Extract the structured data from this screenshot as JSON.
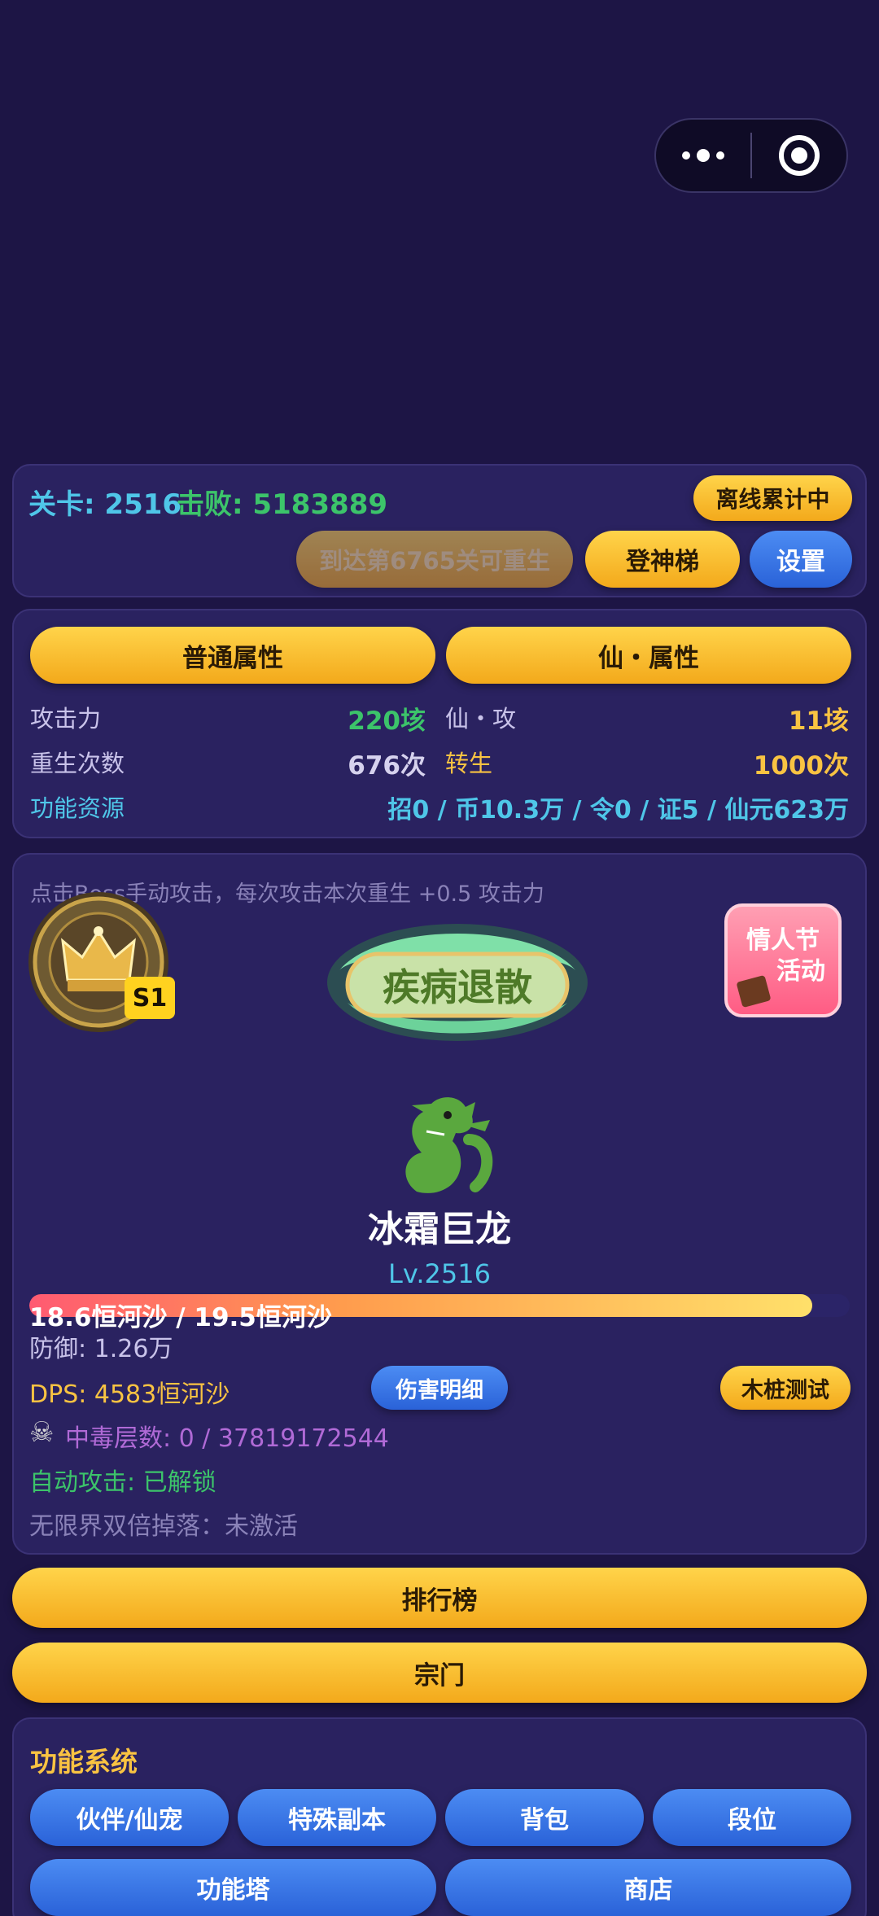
{
  "top": {
    "level_label": "关卡: 2516",
    "kills_label": "击败: 5183889",
    "offline_btn": "离线累计中",
    "rebirth_btn": "到达第6765关可重生",
    "ladder_btn": "登神梯",
    "settings_btn": "设置"
  },
  "attrs": {
    "tab_normal": "普通属性",
    "tab_immortal": "仙・属性",
    "attack_label": "攻击力",
    "attack_value": "220垓",
    "immortal_attack_label": "仙・攻",
    "immortal_attack_value": "11垓",
    "rebirth_label": "重生次数",
    "rebirth_value": "676次",
    "reincarnation_label": "转生",
    "reincarnation_value": "1000次",
    "resources_label": "功能资源",
    "resources_value": "招0 / 币10.3万 / 令0 / 证5 / 仙元623万"
  },
  "battle": {
    "hint": "点击Boss手动攻击，每次攻击本次重生 +0.5 攻击力",
    "season_badge": "S1",
    "banner_text": "疾病退散",
    "event_line1": "情人节",
    "event_line2": "活动",
    "boss_name": "冰霜巨龙",
    "boss_level": "Lv.2516",
    "hp_text": "18.6恒河沙 / 19.5恒河沙",
    "hp_fraction": 0.954,
    "defense": "防御: 1.26万",
    "dps": "DPS: 4583恒河沙",
    "damage_detail_btn": "伤害明细",
    "dummy_test_btn": "木桩测试",
    "poison_icon": "skull-crossbones-icon",
    "poison_text": "中毒层数: 0 / 37819172544",
    "auto_attack": "自动攻击: 已解锁",
    "double_drop": "无限界双倍掉落：未激活"
  },
  "actions": {
    "leaderboard": "排行榜",
    "sect": "宗门"
  },
  "systems": {
    "title": "功能系统",
    "buttons": [
      "伙伴/仙宠",
      "特殊副本",
      "背包",
      "段位",
      "功能塔",
      "商店"
    ]
  },
  "colors": {
    "gold": "#f9b92a",
    "blue": "#3a76e6",
    "cyan": "#4fc6e8",
    "green": "#3cc46a",
    "purple": "#b06ad6"
  }
}
